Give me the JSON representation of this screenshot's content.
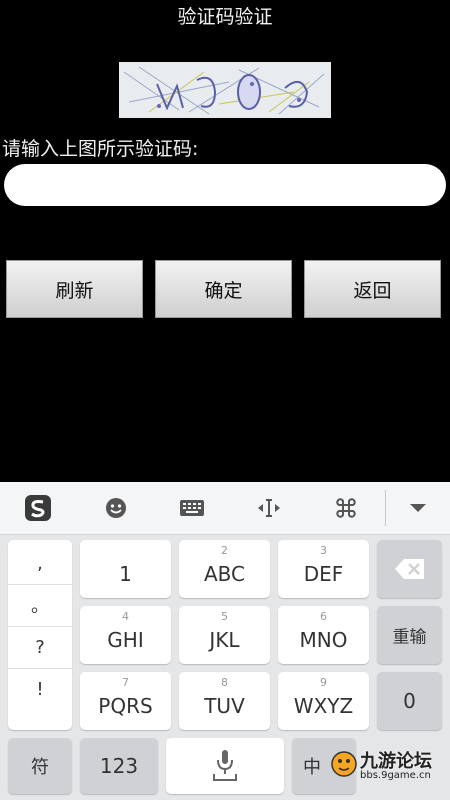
{
  "page": {
    "title": "验证码验证",
    "prompt": "请输入上图所示验证码:",
    "input_value": "",
    "buttons": {
      "refresh": "刷新",
      "confirm": "确定",
      "back": "返回"
    }
  },
  "keyboard": {
    "punctuation": [
      ",",
      "。",
      "?",
      "!"
    ],
    "keys": [
      {
        "sub": "",
        "main": "1"
      },
      {
        "sub": "2",
        "main": "ABC"
      },
      {
        "sub": "3",
        "main": "DEF"
      },
      {
        "sub": "4",
        "main": "GHI"
      },
      {
        "sub": "5",
        "main": "JKL"
      },
      {
        "sub": "6",
        "main": "MNO"
      },
      {
        "sub": "7",
        "main": "PQRS"
      },
      {
        "sub": "8",
        "main": "TUV"
      },
      {
        "sub": "9",
        "main": "WXYZ"
      }
    ],
    "reenter": "重输",
    "zero": "0",
    "symbols": "符",
    "numbers": "123",
    "chinese": "中"
  },
  "watermark": {
    "brand": "九游论坛",
    "site": "bbs.9game.cn"
  }
}
